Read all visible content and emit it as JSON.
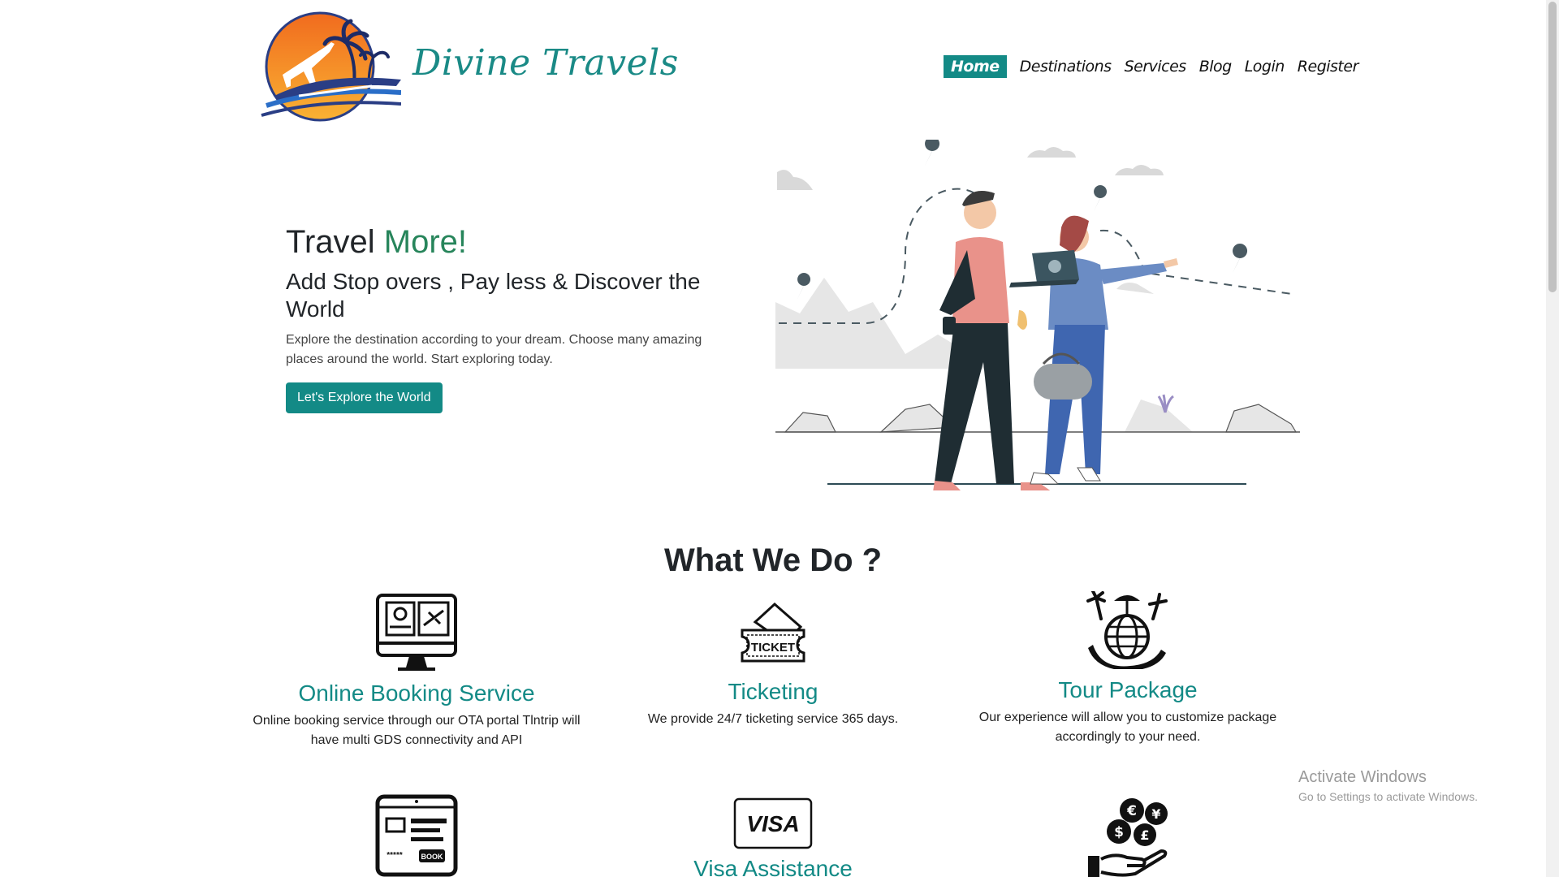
{
  "header": {
    "brand": "Divine Travels",
    "nav": [
      "Home",
      "Destinations",
      "Services",
      "Blog",
      "Login",
      "Register"
    ],
    "active_nav": "Home"
  },
  "hero": {
    "title_part1": "Travel",
    "title_part2": "More!",
    "subtitle": "Add Stop overs , Pay less & Discover the World",
    "description": "Explore the destination according to your dream. Choose many amazing places around the world. Start exploring today.",
    "button": "Let's Explore the World"
  },
  "what_we_do": {
    "heading": "What We Do ?",
    "services": [
      {
        "icon": "online-booking-icon",
        "title": "Online Booking Service",
        "text": "Online booking service through our OTA portal Tlntrip will have multi GDS connectivity and API"
      },
      {
        "icon": "ticket-icon",
        "title": "Ticketing",
        "text": "We provide 24/7 ticketing service 365 days.",
        "icon_label": "TICKET"
      },
      {
        "icon": "tour-package-icon",
        "title": "Tour Package",
        "text": "Our experience will allow you to customize package accordingly to your need."
      },
      {
        "icon": "hotel-booking-icon",
        "icon_label": "BOOK"
      },
      {
        "icon": "visa-icon",
        "title": "Visa Assistance",
        "icon_label": "VISA"
      },
      {
        "icon": "currency-exchange-icon"
      }
    ]
  },
  "watermark": {
    "line1": "Activate Windows",
    "line2": "Go to Settings to activate Windows."
  },
  "colors": {
    "primary": "#138a86",
    "accent_green": "#27855b"
  }
}
